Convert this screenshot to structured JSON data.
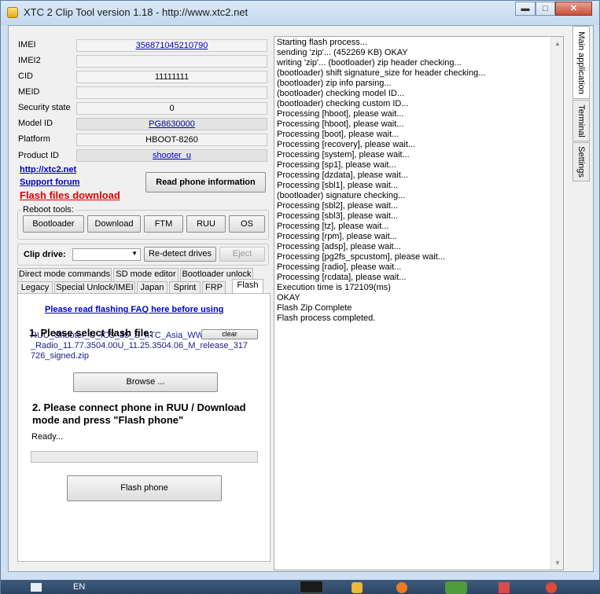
{
  "window": {
    "title": "XTC 2 Clip Tool version 1.18 - http://www.xtc2.net",
    "minimize": "▬",
    "maximize": "□",
    "close": "✕"
  },
  "info": {
    "imei_label": "IMEI",
    "imei_value": "356871045210790",
    "imei2_label": "IMEI2",
    "imei2_value": "",
    "cid_label": "CID",
    "cid_value": "11111111",
    "meid_label": "MEID",
    "meid_value": "",
    "security_label": "Security state",
    "security_value": "0",
    "model_label": "Model ID",
    "model_value": "PG8630000",
    "platform_label": "Platform",
    "platform_value": "HBOOT-8260",
    "product_label": "Product ID",
    "product_value": "shooter_u"
  },
  "links": {
    "site": "http://xtc2.net",
    "forum": "Support forum",
    "flash": "Flash files download"
  },
  "read_button": "Read phone information",
  "reboot": {
    "label": "Reboot tools:",
    "buttons": [
      "Bootloader",
      "Download",
      "FTM",
      "RUU",
      "OS"
    ]
  },
  "clip": {
    "label": "Clip drive:",
    "value": "",
    "redetect": "Re-detect drives",
    "eject": "Eject"
  },
  "tabs_row1": [
    "Direct mode commands",
    "SD mode editor",
    "Bootloader unlock"
  ],
  "tabs_row2": [
    "Legacy",
    "Special Unlock/IMEI",
    "Japan",
    "Sprint",
    "FRP",
    "Flash"
  ],
  "flash_tab": {
    "faq_link": "Please read flashing FAQ here before using",
    "step1": "1. Please select flash file:",
    "file_line1": "RUU_Shooter_U_ICS_35_S_hTC_Asia_WWE_3.28.707.3",
    "file_line2": "_Radio_11.77.3504.00U_11.25.3504.06_M_release_317",
    "file_line3": "726_signed.zip",
    "clear": "clear",
    "browse": "Browse ...",
    "step2_line1": "2. Please connect phone in RUU / Download",
    "step2_line2": "mode and press \"Flash phone\"",
    "status": "Ready...",
    "progress": 0,
    "flash_button": "Flash phone"
  },
  "log": [
    "Starting flash process...",
    "sending 'zip'... (452269 KB) OKAY",
    "writing 'zip'... (bootloader) zip header checking...",
    "(bootloader) shift signature_size for header checking...",
    "(bootloader) zip info parsing...",
    "(bootloader) checking model ID...",
    "(bootloader) checking custom ID...",
    "Processing [hboot], please wait...",
    "Processing [hboot], please wait...",
    "Processing [boot], please wait...",
    "Processing [recovery], please wait...",
    "Processing [system], please wait...",
    "Processing [sp1], please wait...",
    "Processing [dzdata], please wait...",
    "Processing [sbl1], please wait...",
    "(bootloader) signature checking...",
    "Processing [sbl2], please wait...",
    "Processing [sbl3], please wait...",
    "Processing [tz], please wait...",
    "Processing [rpm], please wait...",
    "Processing [adsp], please wait...",
    "Processing [pg2fs_spcustom], please wait...",
    "Processing [radio], please wait...",
    "Processing [rcdata], please wait...",
    "Execution time is 172109(ms)",
    "OKAY",
    "Flash Zip Complete",
    "Flash process completed."
  ],
  "side_tabs": [
    "Main application",
    "Terminal",
    "Settings"
  ],
  "taskbar": {
    "lang": "EN"
  }
}
